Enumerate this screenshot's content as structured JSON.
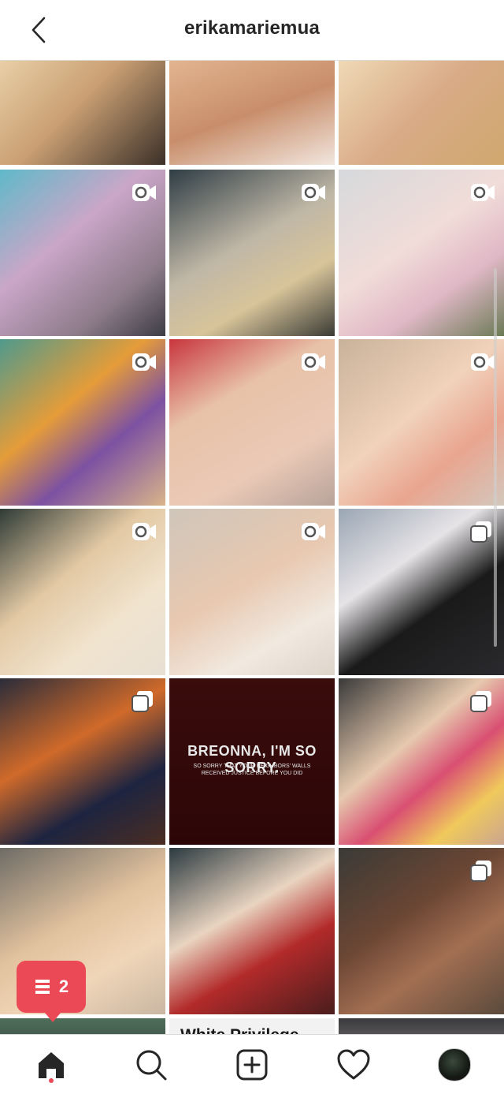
{
  "header": {
    "title": "erikamariemua"
  },
  "grid": {
    "tiles": [
      {
        "name": "post-1-1",
        "bg": "linear-gradient(135deg,#e9cfa6 0%,#c99f73 45%,#3b3028 100%)",
        "badge": "none"
      },
      {
        "name": "post-1-2",
        "bg": "linear-gradient(160deg,#e2b48f 0%,#c88e6b 50%,#f2e6de 100%)",
        "badge": "none"
      },
      {
        "name": "post-1-3",
        "bg": "linear-gradient(135deg,#efd9b6 0%,#d9aa86 50%,#cfa86e 100%)",
        "badge": "none"
      },
      {
        "name": "post-2-1",
        "bg": "linear-gradient(140deg,#5fb9c9 0%,#caa6c8 40%,#8d7b8a 75%,#3c3c44 100%)",
        "badge": "video"
      },
      {
        "name": "post-2-2",
        "bg": "linear-gradient(150deg,#2f3d45 0%,#bfb7a6 45%,#d8c49a 70%,#3a3b35 100%)",
        "badge": "video"
      },
      {
        "name": "post-2-3",
        "bg": "linear-gradient(145deg,#d6d9dc 0%,#f1dcd8 45%,#e0b8c6 70%,#6b7a55 100%)",
        "badge": "video"
      },
      {
        "name": "post-3-1",
        "bg": "linear-gradient(140deg,#4f9a8c 0%,#e59c39 40%,#7c51a2 65%,#d9b48a 100%)",
        "badge": "video"
      },
      {
        "name": "post-3-2",
        "bg": "linear-gradient(150deg,#c8353d 0%,#e8c2a8 35%,#eac9b6 70%,#b8a39a 100%)",
        "badge": "video"
      },
      {
        "name": "post-3-3",
        "bg": "linear-gradient(140deg,#c9b29a 0%,#f1d2bb 45%,#e9a58f 70%,#d3c7bc 100%)",
        "badge": "video"
      },
      {
        "name": "post-4-1",
        "bg": "linear-gradient(140deg,#2f3b36 0%,#e3c9a4 40%,#f1e4cf 70%,#e8e0d4 100%)",
        "badge": "video"
      },
      {
        "name": "post-4-2",
        "bg": "linear-gradient(150deg,#cfc6ba 0%,#e8c8b0 45%,#f1e9e0 75%,#ddd5ca 100%)",
        "badge": "video"
      },
      {
        "name": "post-4-3",
        "bg": "linear-gradient(145deg,#9aa6b4 0%,#e6e3e6 35%,#1a1a1a 60%,#2a2a2e 100%)",
        "badge": "carousel"
      },
      {
        "name": "post-5-1",
        "bg": "linear-gradient(150deg,#2a2c3a 0%,#d06a2a 40%,#1d2440 70%,#4b2d22 100%)",
        "badge": "carousel"
      },
      {
        "name": "post-5-2",
        "bg": "linear-gradient(180deg,#3a0c0c 0%,#2c0607 100%)",
        "badge": "none",
        "text_lines": [
          "BREONNA, I'M SO SORRY.",
          "SO SORRY THAT YOUR NEIGHBORS' WALLS",
          "RECEIVED JUSTICE BEFORE YOU DID"
        ]
      },
      {
        "name": "post-5-3",
        "bg": "linear-gradient(140deg,#3a3a3a 0%,#e6c9ae 40%,#d94f72 60%,#f0c95c 80%,#caa58f 100%)",
        "badge": "carousel"
      },
      {
        "name": "post-6-1",
        "bg": "linear-gradient(150deg,#6e6c66 0%,#e2c29e 45%,#f0d6b8 70%,#c9b6a2 100%)",
        "badge": "none"
      },
      {
        "name": "post-6-2",
        "bg": "linear-gradient(150deg,#2b3a40 0%,#e9d4c0 40%,#b22a2a 65%,#4a1d1d 100%)",
        "badge": "none"
      },
      {
        "name": "post-6-3",
        "bg": "linear-gradient(145deg,#3a3a36 0%,#6b4634 40%,#a36f52 65%,#5b4a3c 100%)",
        "badge": "carousel"
      },
      {
        "name": "post-7-1",
        "bg": "linear-gradient(180deg,#4e6e5a 0%,#3c4e44 100%)",
        "badge": "none"
      },
      {
        "name": "post-7-2",
        "bg": "#f2f2f2",
        "badge": "none",
        "text_lines": [
          "White Privilege"
        ]
      },
      {
        "name": "post-7-3",
        "bg": "linear-gradient(180deg,#3a3a3e 0%,#6e6a6a 100%)",
        "badge": "none"
      }
    ]
  },
  "activity_bubble": {
    "count": "2",
    "color": "#ec4956"
  },
  "tabbar": {
    "tabs": [
      "home",
      "search",
      "new-post",
      "activity",
      "profile"
    ]
  }
}
